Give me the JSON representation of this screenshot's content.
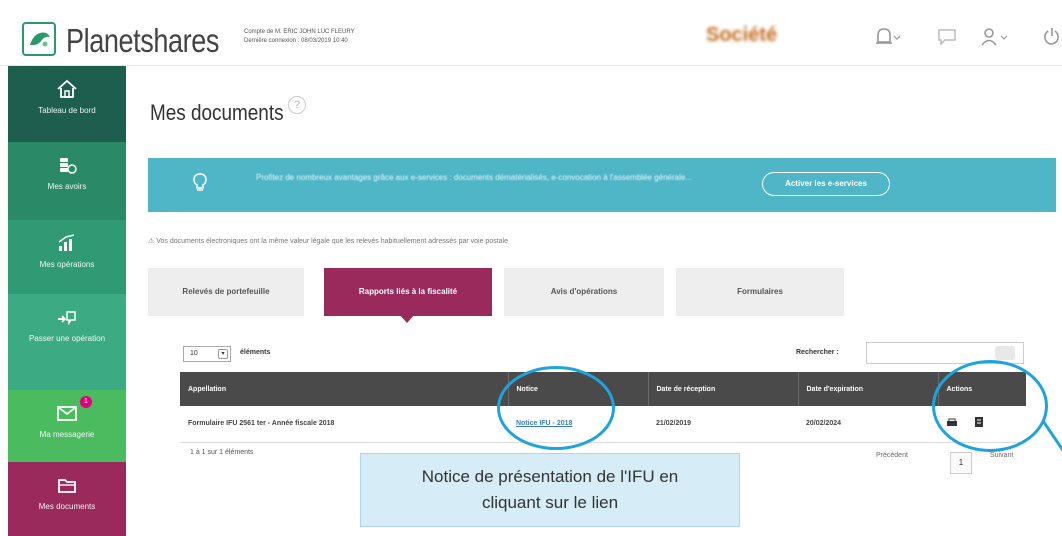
{
  "header": {
    "brand": "Planetshares",
    "account_line1": "Compte de M. ERIC JOHN LUC FLEURY",
    "account_line2": "Dernière connexion : 08/03/2019 10:40",
    "company": "Société",
    "icons": [
      "bell-icon",
      "chat-icon",
      "user-icon",
      "power-icon"
    ]
  },
  "sidebar": {
    "items": [
      {
        "label": "Tableau de bord",
        "icon": "home-icon",
        "color": "#1e5e4e"
      },
      {
        "label": "Mes avoirs",
        "icon": "coins-icon",
        "color": "#2a8a67"
      },
      {
        "label": "Mes opérations",
        "icon": "chart-icon",
        "color": "#2f9a74"
      },
      {
        "label": "Passer une opération",
        "icon": "transfer-icon",
        "color": "#3cab83"
      },
      {
        "label": "Ma messagerie",
        "icon": "mail-icon",
        "color": "#4bbb5f"
      },
      {
        "label": "Mes documents",
        "icon": "folder-icon",
        "color": "#9b2a5c"
      }
    ]
  },
  "main": {
    "title": "Mes documents",
    "help": "?",
    "banner": {
      "text": "Profitez de nombreux avantages grâce aux e-services : documents dématérialisés, e-convocation à l'assemblée générale...",
      "button": "Activer les e-services"
    },
    "notice": "Vos documents électroniques ont la même valeur légale que les relevés habituellement adressés par voie postale",
    "tabs": [
      {
        "label": "Relevés de portefeuille",
        "active": false
      },
      {
        "label": "Rapports liés à la fiscalité",
        "active": true
      },
      {
        "label": "Avis d'opérations",
        "active": false
      },
      {
        "label": "Formulaires",
        "active": false
      }
    ],
    "page_length": "10",
    "page_length_label": "éléments",
    "search_label": "Rechercher :",
    "columns": [
      "Appellation",
      "Notice",
      "Date de réception",
      "Date d'expiration",
      "Actions"
    ],
    "rows": [
      {
        "appellation": "Formulaire IFU 2561 ter - Année fiscale 2018",
        "notice": "Notice IFU - 2018",
        "date_reception": "21/02/2019",
        "date_expiration": "20/02/2024"
      }
    ],
    "info": "1 à 1 sur 1 éléments",
    "pagination": {
      "previous": "Précédent",
      "current": "1",
      "next": "Suivant"
    },
    "callout": {
      "line1": "Notice de présentation de l'IFU en",
      "line2": "cliquant sur le lien"
    },
    "message_badge": "1"
  }
}
